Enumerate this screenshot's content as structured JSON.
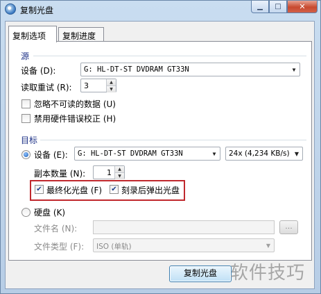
{
  "window": {
    "title": "复制光盘"
  },
  "tabs": [
    {
      "label": "复制选项",
      "active": true
    },
    {
      "label": "复制进度",
      "active": false
    }
  ],
  "source": {
    "group_label": "源",
    "device_label": "设备 (D):",
    "device_value": "G: HL-DT-ST DVDRAM GT33N",
    "retry_label": "读取重试 (R):",
    "retry_value": "3",
    "ignore_unreadable_label": "忽略不可读的数据 (U)",
    "ignore_unreadable_checked": false,
    "disable_hw_ecc_label": "禁用硬件错误校正 (H)",
    "disable_hw_ecc_checked": false
  },
  "target": {
    "group_label": "目标",
    "device_radio_label": "设备 (E):",
    "device_radio_checked": true,
    "device_value": "G: HL-DT-ST DVDRAM GT33N",
    "speed_value": "24x (4,234 KB/s)",
    "copies_label": "副本数量 (N):",
    "copies_value": "1",
    "finalize_label": "最终化光盘 (F)",
    "finalize_checked": true,
    "eject_label": "刻录后弹出光盘",
    "eject_checked": true,
    "harddisk_label": "硬盘 (K)",
    "harddisk_checked": false,
    "filename_label": "文件名 (N):",
    "filename_value": "",
    "browse_label": "...",
    "filetype_label": "文件类型 (F):",
    "filetype_value": "ISO (单轨)"
  },
  "footer": {
    "copy_button_label": "复制光盘"
  },
  "watermark": {
    "text": "软件技巧"
  },
  "icons": {
    "dropdown": "▼",
    "spin_up": "▲",
    "spin_down": "▼",
    "check": "✔",
    "minimize": "▁",
    "maximize": "□",
    "close": "✕"
  },
  "colors": {
    "highlight": "#c0282d",
    "group_label": "#1e3287"
  }
}
